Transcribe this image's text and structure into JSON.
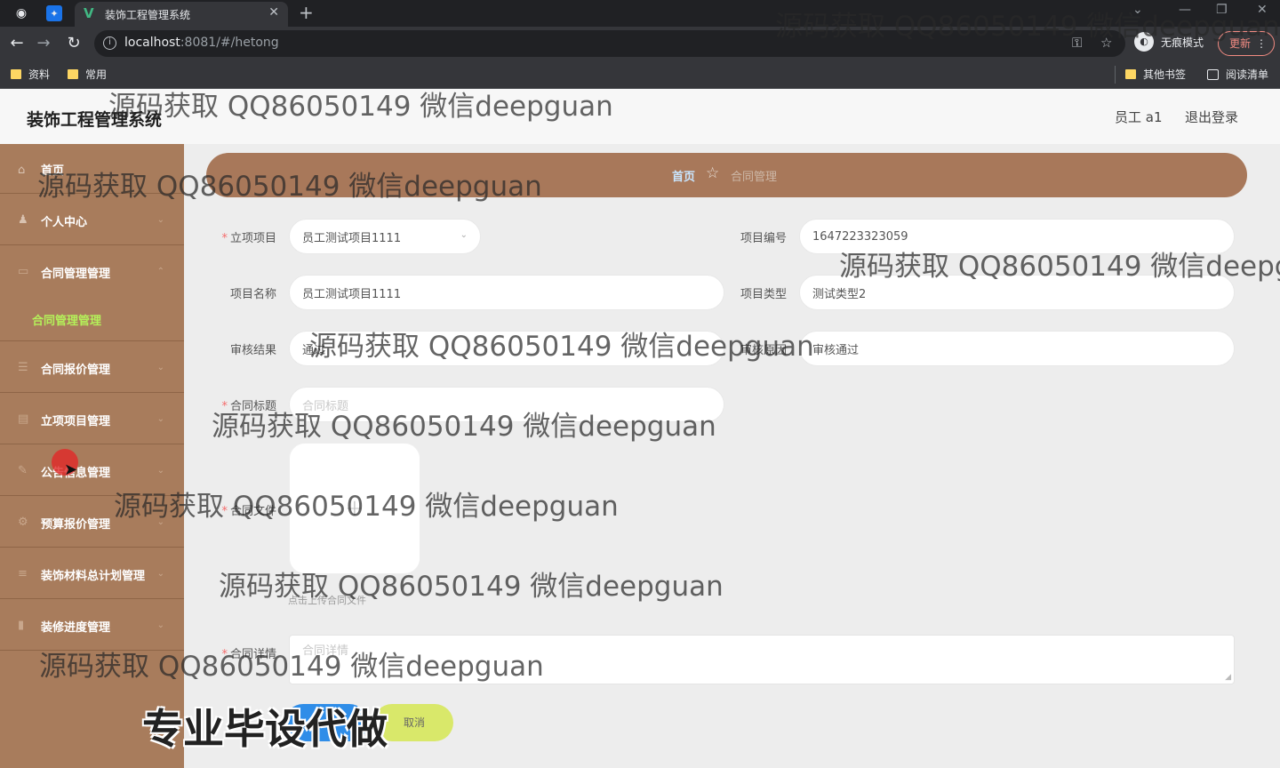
{
  "browser": {
    "tab_title": "装饰工程管理系统",
    "tab_logo": "V",
    "url_host": "localhost",
    "url_rest": ":8081/#/hetong",
    "incognito_label": "无痕模式",
    "update_label": "更新",
    "bookmarks": [
      "资料",
      "常用"
    ],
    "other_bookmarks": "其他书签",
    "reading_list": "阅读清单"
  },
  "header": {
    "title": "装饰工程管理系统",
    "user": "员工 a1",
    "logout": "退出登录"
  },
  "sidebar": {
    "items": [
      {
        "label": "首页"
      },
      {
        "label": "个人中心"
      },
      {
        "label": "合同管理管理",
        "sub": "合同管理管理"
      },
      {
        "label": "合同报价管理"
      },
      {
        "label": "立项项目管理"
      },
      {
        "label": "公告信息管理"
      },
      {
        "label": "预算报价管理"
      },
      {
        "label": "装饰材料总计划管理"
      },
      {
        "label": "装修进度管理"
      }
    ]
  },
  "breadcrumb": {
    "home": "首页",
    "current": "合同管理"
  },
  "form": {
    "project": {
      "label": "立项项目",
      "value": "员工测试项目1111"
    },
    "project_no": {
      "label": "项目编号",
      "value": "1647223323059"
    },
    "project_name": {
      "label": "项目名称",
      "value": "员工测试项目1111"
    },
    "project_type": {
      "label": "项目类型",
      "value": "测试类型2"
    },
    "review_result": {
      "label": "审核结果",
      "value": "通过"
    },
    "review_reason": {
      "label": "审核原因",
      "value": "审核通过"
    },
    "contract_title": {
      "label": "合同标题",
      "placeholder": "合同标题"
    },
    "contract_file": {
      "label": "合同文件",
      "tip": "点击上传合同文件"
    },
    "contract_detail": {
      "label": "合同详情",
      "placeholder": "合同详情"
    },
    "cancel_label": "取消"
  },
  "overlay": {
    "watermark": "源码获取 QQ86050149 微信deepguan",
    "promo": "专业毕设代做"
  },
  "colors": {
    "sidebar": "#a87c5c",
    "breadcrumb": "#a8785a",
    "submenu_active": "#b4f05a",
    "cancel_button": "#d9e86a",
    "submit_button": "#2f8de8"
  }
}
